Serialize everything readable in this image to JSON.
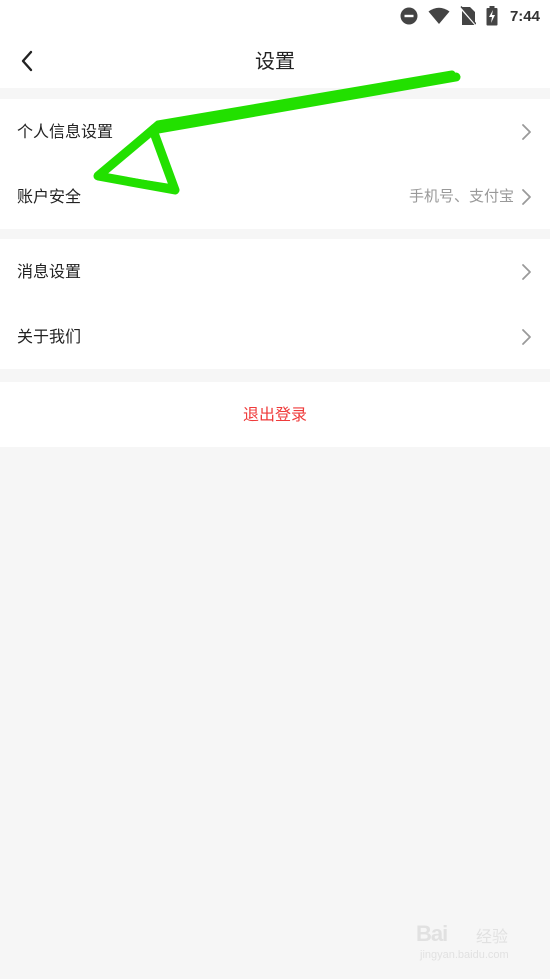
{
  "status_bar": {
    "time": "7:44",
    "icons": [
      "do-not-disturb-icon",
      "wifi-icon",
      "no-sim-icon",
      "battery-charging-icon"
    ]
  },
  "header": {
    "title": "设置",
    "back_icon": "chevron-left-icon"
  },
  "groups": [
    {
      "items": [
        {
          "label": "个人信息设置",
          "value": ""
        },
        {
          "label": "账户安全",
          "value": "手机号、支付宝"
        }
      ]
    },
    {
      "items": [
        {
          "label": "消息设置",
          "value": ""
        },
        {
          "label": "关于我们",
          "value": ""
        }
      ]
    }
  ],
  "logout": {
    "label": "退出登录",
    "color": "#ef3b3b"
  },
  "annotation": {
    "type": "arrow",
    "color": "#22e000",
    "points_to": "账户安全"
  },
  "watermark": {
    "brand": "Bai",
    "sub": "经验",
    "url": "jingyan.baidu.com"
  },
  "colors": {
    "background": "#f6f6f6",
    "surface": "#ffffff",
    "text_primary": "#222222",
    "text_secondary": "#999999",
    "chevron": "#9a9a9a"
  }
}
